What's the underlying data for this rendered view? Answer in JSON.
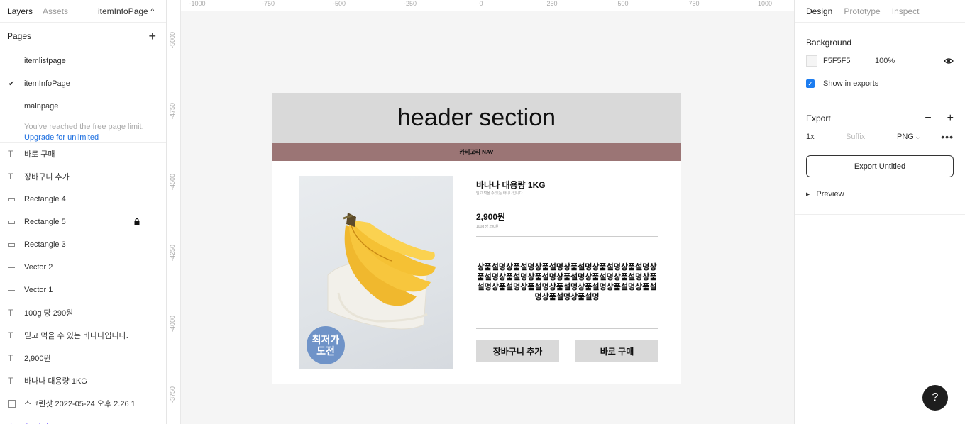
{
  "left_panel": {
    "tabs": [
      "Layers",
      "Assets"
    ],
    "page_switcher": "itemInfoPage ^",
    "pages_title": "Pages",
    "pages": [
      {
        "label": "itemlistpage",
        "checked": false
      },
      {
        "label": "itemInfoPage",
        "checked": true
      },
      {
        "label": "mainpage",
        "checked": false
      }
    ],
    "limit_note": "You've reached the free page limit.",
    "limit_link": "Upgrade for unlimited",
    "layers": [
      {
        "label": "바로 구매",
        "icon": "text-icon"
      },
      {
        "label": "장바구니 추가",
        "icon": "text-icon"
      },
      {
        "label": "Rectangle 4",
        "icon": "rectangle-icon"
      },
      {
        "label": "Rectangle 5",
        "icon": "rectangle-icon",
        "locked": true
      },
      {
        "label": "Rectangle 3",
        "icon": "rectangle-icon"
      },
      {
        "label": "Vector 2",
        "icon": "line-icon"
      },
      {
        "label": "Vector 1",
        "icon": "line-icon"
      },
      {
        "label": "100g 당 290원",
        "icon": "text-icon"
      },
      {
        "label": "믿고 먹을 수 있는 바나나입니다.",
        "icon": "text-icon"
      },
      {
        "label": "2,900원",
        "icon": "text-icon"
      },
      {
        "label": "바나나 대용량 1KG",
        "icon": "text-icon"
      },
      {
        "label": "스크린샷 2022-05-24 오후 2.26 1",
        "icon": "image-icon"
      },
      {
        "label": "itemlist",
        "icon": "component-icon"
      }
    ]
  },
  "canvas": {
    "ruler_top": [
      "-1000",
      "-750",
      "-500",
      "-250",
      "0",
      "250",
      "500",
      "750",
      "1000"
    ],
    "ruler_left": [
      "-5000",
      "-4750",
      "-4500",
      "-4250",
      "-4000",
      "-3750"
    ],
    "frame": {
      "header": "header section",
      "category_nav": "카테고리 NAV",
      "badge_line1": "최저가",
      "badge_line2": "도전",
      "product_name": "바나나 대용량 1KG",
      "product_sub": "믿고 먹을 수 있는 바나나입니다.",
      "price": "2,900원",
      "unit_price": "100g 당 290원",
      "description": "상품설명상품설명상품설명상품설명상품설명상품설명상품설명상품설명상품설명상품설명상품설명상품설명상품설명상품설명상품설명상품설명상품설명상품설명상품설명상품설명상품설명",
      "cart_button": "장바구니 추가",
      "buy_button": "바로 구매"
    }
  },
  "right_panel": {
    "tabs": [
      "Design",
      "Prototype",
      "Inspect"
    ],
    "background_title": "Background",
    "bg_color": "F5F5F5",
    "bg_opacity": "100%",
    "show_in_exports": "Show in exports",
    "export_title": "Export",
    "scale": "1x",
    "suffix_placeholder": "Suffix",
    "format": "PNG",
    "export_button": "Export Untitled",
    "preview": "Preview"
  },
  "help": "?"
}
